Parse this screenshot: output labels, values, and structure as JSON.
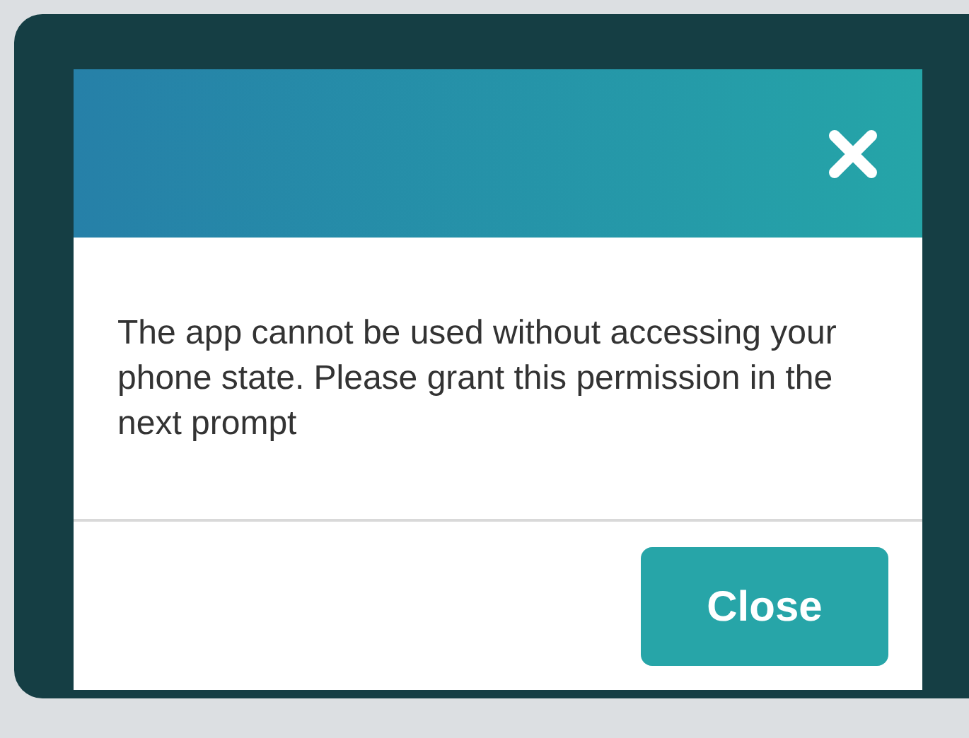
{
  "dialog": {
    "message": "The app cannot be used without accessing your phone state. Please grant this permission in the next prompt",
    "buttons": [
      "Close"
    ]
  }
}
